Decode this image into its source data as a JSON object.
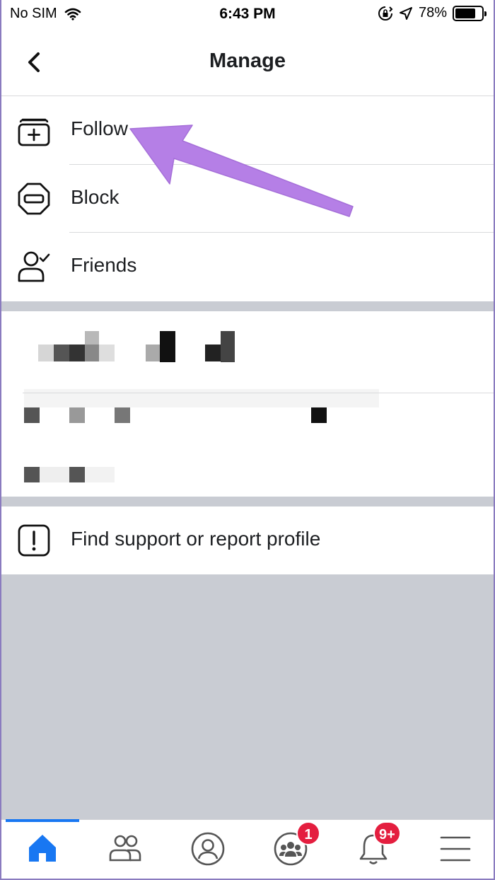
{
  "status_bar": {
    "carrier": "No SIM",
    "time": "6:43 PM",
    "battery": "78%",
    "battery_level": 0.78
  },
  "header": {
    "title": "Manage",
    "back_icon": "chevron-left-icon"
  },
  "menu": {
    "follow": {
      "label": "Follow",
      "icon": "follow-add-icon"
    },
    "block": {
      "label": "Block",
      "icon": "block-icon"
    },
    "friends": {
      "label": "Friends",
      "icon": "friends-check-icon"
    },
    "support": {
      "label": "Find support or report profile",
      "icon": "exclamation-icon"
    }
  },
  "tab_bar": {
    "tabs": [
      {
        "icon": "home-icon",
        "active": true
      },
      {
        "icon": "friends-icon"
      },
      {
        "icon": "profile-icon"
      },
      {
        "icon": "groups-icon",
        "badge": "1"
      },
      {
        "icon": "notifications-icon",
        "badge": "9+"
      },
      {
        "icon": "menu-icon"
      }
    ]
  },
  "colors": {
    "accent": "#1877f2",
    "badge": "#e41e3f",
    "arrow": "#b57fe6",
    "separator": "#c9ccd3"
  }
}
